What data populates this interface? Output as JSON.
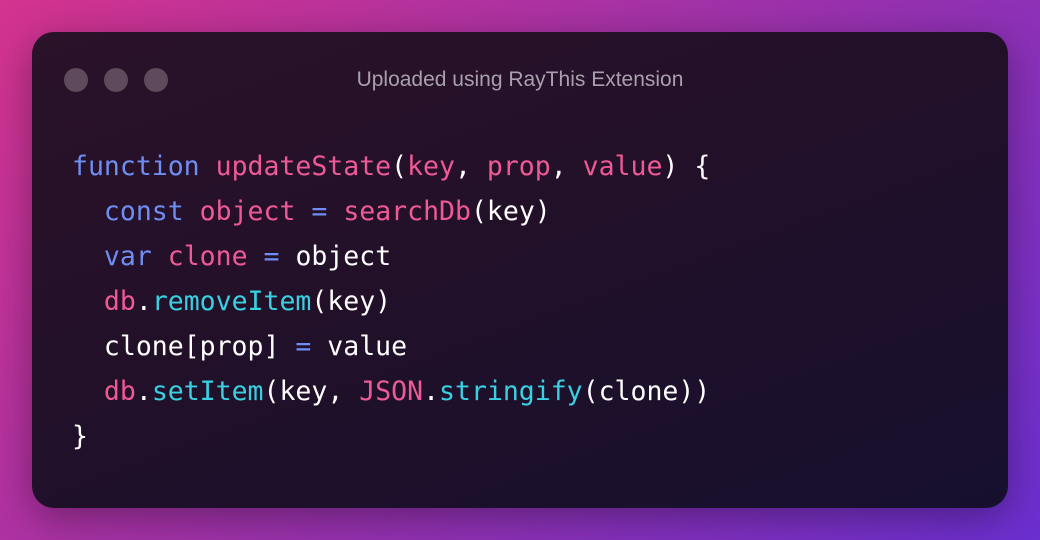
{
  "window": {
    "title": "Uploaded using RayThis Extension",
    "controls": [
      "window-dot-1",
      "window-dot-2",
      "window-dot-3"
    ]
  },
  "code": {
    "language": "javascript",
    "lines": [
      {
        "tokens": [
          {
            "text": "function",
            "kind": "keyword"
          },
          {
            "text": " ",
            "kind": "plain"
          },
          {
            "text": "updateState",
            "kind": "function-name"
          },
          {
            "text": "(",
            "kind": "plain"
          },
          {
            "text": "key",
            "kind": "param"
          },
          {
            "text": ", ",
            "kind": "plain"
          },
          {
            "text": "prop",
            "kind": "param"
          },
          {
            "text": ", ",
            "kind": "plain"
          },
          {
            "text": "value",
            "kind": "param"
          },
          {
            "text": ") {",
            "kind": "plain"
          }
        ]
      },
      {
        "tokens": [
          {
            "text": "  ",
            "kind": "plain"
          },
          {
            "text": "const",
            "kind": "keyword"
          },
          {
            "text": " ",
            "kind": "plain"
          },
          {
            "text": "object",
            "kind": "variable"
          },
          {
            "text": " ",
            "kind": "plain"
          },
          {
            "text": "=",
            "kind": "operator"
          },
          {
            "text": " ",
            "kind": "plain"
          },
          {
            "text": "searchDb",
            "kind": "function-name"
          },
          {
            "text": "(key)",
            "kind": "plain"
          }
        ]
      },
      {
        "tokens": [
          {
            "text": "  ",
            "kind": "plain"
          },
          {
            "text": "var",
            "kind": "keyword"
          },
          {
            "text": " ",
            "kind": "plain"
          },
          {
            "text": "clone",
            "kind": "variable"
          },
          {
            "text": " ",
            "kind": "plain"
          },
          {
            "text": "=",
            "kind": "operator"
          },
          {
            "text": " object",
            "kind": "plain"
          }
        ]
      },
      {
        "tokens": [
          {
            "text": "  ",
            "kind": "plain"
          },
          {
            "text": "db",
            "kind": "variable"
          },
          {
            "text": ".",
            "kind": "plain"
          },
          {
            "text": "removeItem",
            "kind": "method"
          },
          {
            "text": "(key)",
            "kind": "plain"
          }
        ]
      },
      {
        "tokens": [
          {
            "text": "  clone[prop] ",
            "kind": "plain"
          },
          {
            "text": "=",
            "kind": "operator"
          },
          {
            "text": " value",
            "kind": "plain"
          }
        ]
      },
      {
        "tokens": [
          {
            "text": "  ",
            "kind": "plain"
          },
          {
            "text": "db",
            "kind": "variable"
          },
          {
            "text": ".",
            "kind": "plain"
          },
          {
            "text": "setItem",
            "kind": "method"
          },
          {
            "text": "(key, ",
            "kind": "plain"
          },
          {
            "text": "JSON",
            "kind": "variable"
          },
          {
            "text": ".",
            "kind": "plain"
          },
          {
            "text": "stringify",
            "kind": "method"
          },
          {
            "text": "(clone))",
            "kind": "plain"
          }
        ]
      },
      {
        "tokens": [
          {
            "text": "}",
            "kind": "plain"
          }
        ]
      }
    ]
  },
  "colors": {
    "keyword": "#6f8ef4",
    "function-name": "#ef5a96",
    "param": "#ef5a96",
    "variable": "#ef5a96",
    "operator": "#6f8ef4",
    "method": "#39d0e2",
    "plain": "#ffffff",
    "window_bg": "#221029",
    "dot": "#5e4a5b",
    "title": "#a9a0ad"
  }
}
